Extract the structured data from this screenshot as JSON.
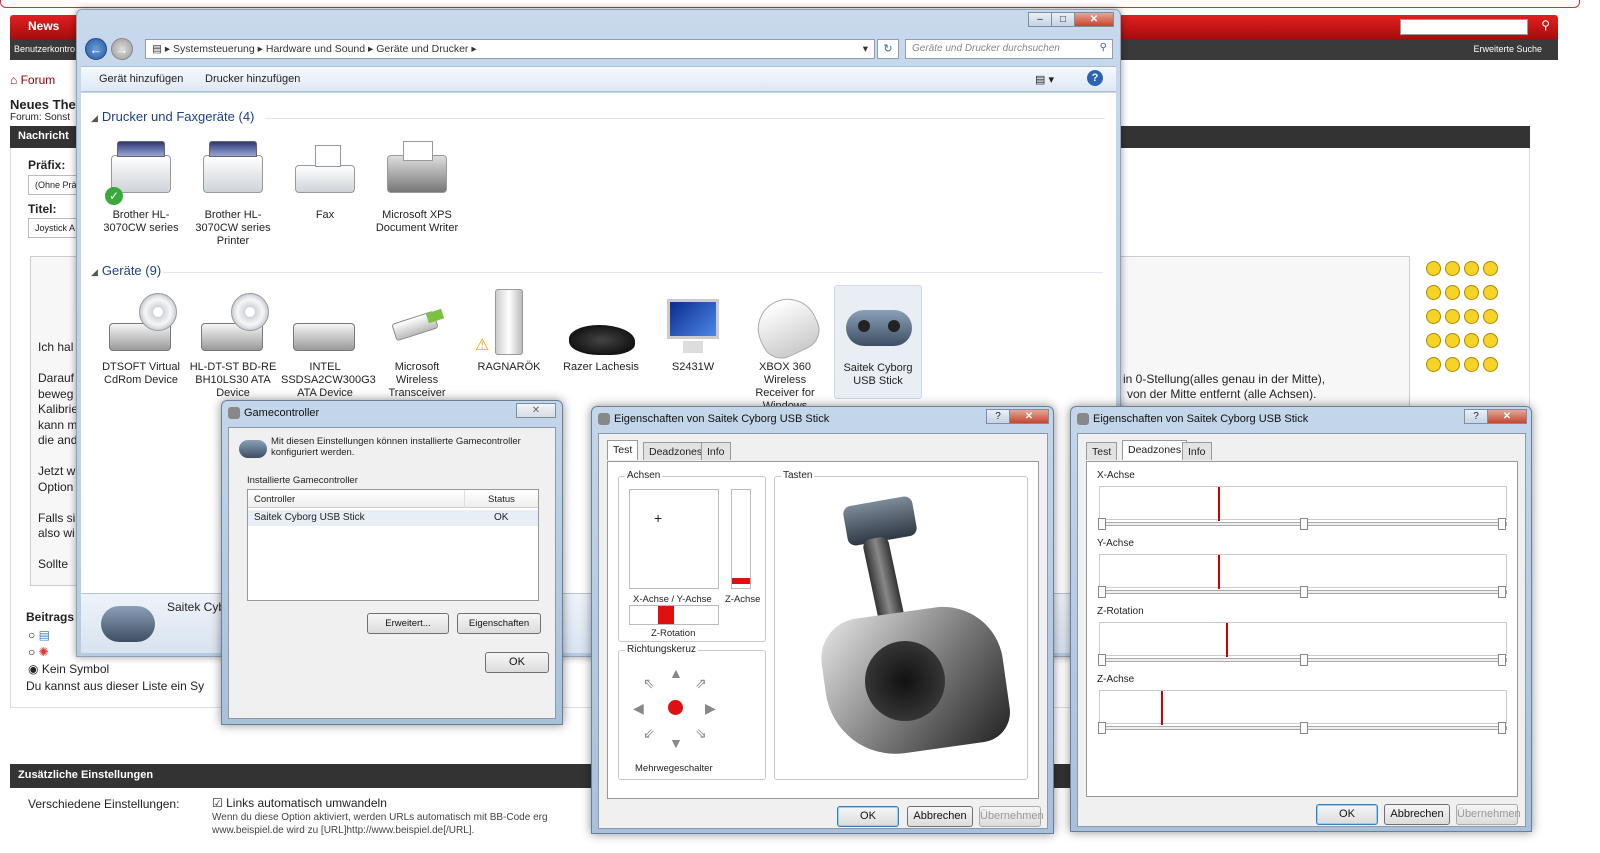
{
  "forum": {
    "nav_news": "News",
    "nav_search_icon": "search-icon",
    "sub_left": "Benutzerkontro",
    "sub_right": "Erweiterte Suche",
    "breadcrumb": "Forum",
    "thread_title": "Neues The",
    "forum_line": "Forum: Sonst",
    "bar_nachricht": "Nachricht",
    "label_praefix": "Präfix:",
    "praefix_value": "(Ohne Prä",
    "label_titel": "Titel:",
    "titel_value": "Joystick A",
    "editor_lines": [
      "Ich hal",
      "",
      "Darauf",
      "beweg",
      "Kalibrie",
      "kann m",
      "die and",
      "",
      "Jetzt w",
      "Option",
      "",
      "Falls si",
      "also wi",
      "",
      "Sollte"
    ],
    "right_line1": "in 0-Stellung(alles genau in der Mitte),",
    "right_line2": "von der Mitte entfernt (alle Achsen).",
    "beitrag_label": "Beitrags",
    "radio_kein": "Kein Symbol",
    "liste_text": "Du kannst aus dieser Liste ein Sy",
    "bar_zusatz": "Zusätzliche Einstellungen",
    "versch_label": "Verschiedene Einstellungen:",
    "links_check": "Links automatisch umwandeln",
    "links_desc1": "Wenn du diese Option aktiviert, werden URLs automatisch mit BB-Code erg",
    "links_desc2": "www.beispiel.de wird zu [URL]http://www.beispiel.de[/URL]."
  },
  "explorer": {
    "path": [
      "Systemsteuerung",
      "Hardware und Sound",
      "Geräte und Drucker"
    ],
    "search_placeholder": "Geräte und Drucker durchsuchen",
    "toolbar_add_device": "Gerät hinzufügen",
    "toolbar_add_printer": "Drucker hinzufügen",
    "group_printers": "Drucker und Faxgeräte (4)",
    "group_devices": "Geräte (9)",
    "printers": [
      {
        "label": "Brother HL-3070CW series",
        "icon": "printer-icon"
      },
      {
        "label": "Brother HL-3070CW series Printer",
        "icon": "printer-icon"
      },
      {
        "label": "Fax",
        "icon": "fax-icon"
      },
      {
        "label": "Microsoft XPS Document Writer",
        "icon": "printer-icon"
      }
    ],
    "devices": [
      {
        "label": "DTSOFT Virtual CdRom Device",
        "icon": "cd-drive-icon"
      },
      {
        "label": "HL-DT-ST BD-RE BH10LS30 ATA Device",
        "icon": "cd-drive-icon"
      },
      {
        "label": "INTEL SSDSA2CW300G3 ATA Device",
        "icon": "drive-icon"
      },
      {
        "label": "Microsoft Wireless Transceiver",
        "icon": "usb-stick-icon"
      },
      {
        "label": "RAGNARÖK",
        "icon": "computer-icon"
      },
      {
        "label": "Razer Lachesis",
        "icon": "mouse-icon"
      },
      {
        "label": "S2431W",
        "icon": "monitor-icon"
      },
      {
        "label": "XBOX 360 Wireless Receiver for Windows",
        "icon": "receiver-icon"
      },
      {
        "label": "Saitek Cyborg USB Stick",
        "icon": "gamepad-icon"
      }
    ],
    "details_name": "Saitek Cybo"
  },
  "gamecontroller": {
    "title": "Gamecontroller",
    "intro": "Mit diesen Einstellungen können installierte Gamecontroller konfiguriert werden.",
    "installed_label": "Installierte Gamecontroller",
    "col_controller": "Controller",
    "col_status": "Status",
    "row_controller": "Saitek Cyborg USB Stick",
    "row_status": "OK",
    "btn_erweitert": "Erweitert...",
    "btn_eigenschaften": "Eigenschaften",
    "btn_ok": "OK"
  },
  "props_test": {
    "title": "Eigenschaften von Saitek Cyborg USB Stick",
    "tabs": [
      "Test",
      "Deadzones",
      "Info"
    ],
    "achsen": "Achsen",
    "tasten": "Tasten",
    "xy_label": "X-Achse / Y-Achse",
    "z_label": "Z-Achse",
    "zrot_label": "Z-Rotation",
    "richtungskreuz": "Richtungskeruz",
    "mehrwege": "Mehrwegeschalter",
    "btn_ok": "OK",
    "btn_abbrechen": "Abbrechen",
    "btn_uebernehmen": "Übernehmen"
  },
  "props_dead": {
    "title": "Eigenschaften von Saitek Cyborg USB Stick",
    "tabs": [
      "Test",
      "Deadzones",
      "Info"
    ],
    "axes": [
      {
        "label": "X-Achse",
        "level": 0.29
      },
      {
        "label": "Y-Achse",
        "level": 0.29
      },
      {
        "label": "Z-Rotation",
        "level": 0.31
      },
      {
        "label": "Z-Achse",
        "level": 0.15
      }
    ],
    "btn_ok": "OK",
    "btn_abbrechen": "Abbrechen",
    "btn_uebernehmen": "Übernehmen"
  }
}
